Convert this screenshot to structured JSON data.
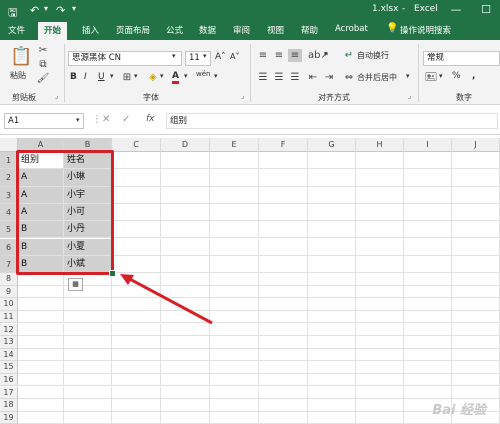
{
  "titlebar": {
    "filename": "1.xlsx",
    "separator": "-",
    "app": "Excel"
  },
  "tabs": [
    "文件",
    "开始",
    "插入",
    "页面布局",
    "公式",
    "数据",
    "审阅",
    "视图",
    "帮助",
    "Acrobat",
    "操作说明搜索"
  ],
  "ribbon": {
    "clipboard_label": "剪贴板",
    "paste_label": "粘贴",
    "font_label": "字体",
    "font_name": "思源黑体 CN",
    "font_size": "11",
    "bold": "B",
    "italic": "I",
    "underline": "U",
    "grow": "A˄",
    "shrink": "A˅",
    "wen": "wén",
    "alignment_label": "对齐方式",
    "wrap_text": "自动换行",
    "merge_center": "合并后居中",
    "number_label": "数字",
    "number_format": "常规",
    "percent": "%",
    "comma": ","
  },
  "formula_bar": {
    "name_box": "A1",
    "fx": "fx",
    "content": "组别"
  },
  "columns": [
    "A",
    "B",
    "C",
    "D",
    "E",
    "F",
    "G",
    "H",
    "I",
    "J"
  ],
  "rows": [
    "1",
    "2",
    "3",
    "4",
    "5",
    "6",
    "7",
    "8",
    "9",
    "10",
    "11",
    "12",
    "13",
    "14",
    "15",
    "16",
    "17",
    "18",
    "19"
  ],
  "table": [
    [
      "组别",
      "姓名"
    ],
    [
      "A",
      "小琳"
    ],
    [
      "A",
      "小宇"
    ],
    [
      "A",
      "小可"
    ],
    [
      "B",
      "小丹"
    ],
    [
      "B",
      "小夏"
    ],
    [
      "B",
      "小斌"
    ]
  ],
  "colors": {
    "excel_green": "#217346",
    "highlight_red": "#d62027",
    "selection_gray": "#d0d0d0"
  },
  "watermark": "Bai 经验"
}
